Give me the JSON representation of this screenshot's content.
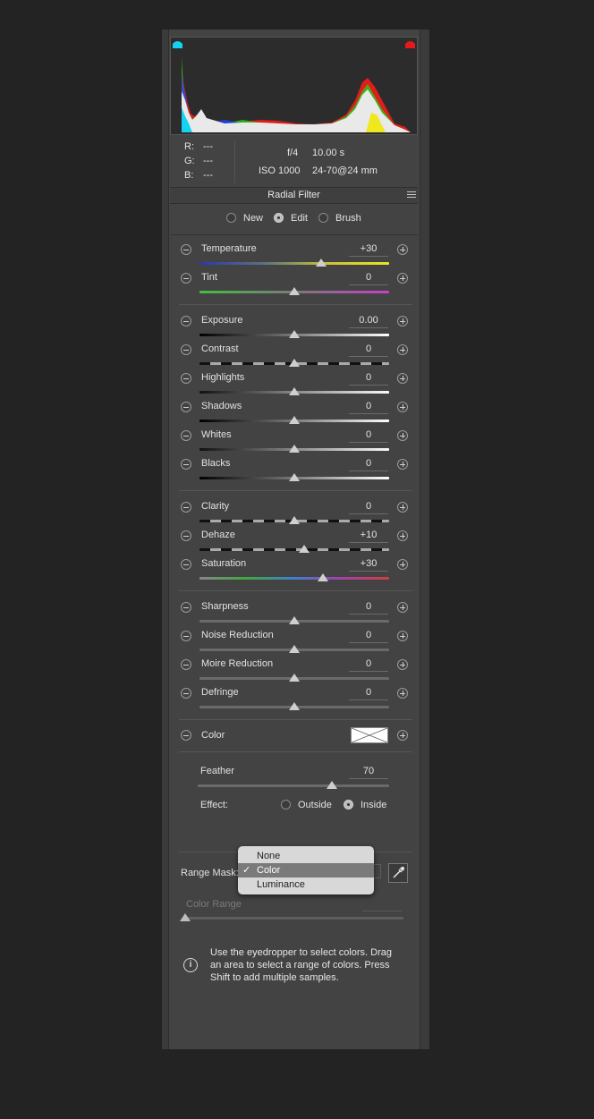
{
  "histogram": {
    "readout": {
      "r_label": "R:",
      "r_val": "---",
      "g_label": "G:",
      "g_val": "---",
      "b_label": "B:",
      "b_val": "---"
    },
    "aperture": "f/4",
    "shutter": "10.00 s",
    "iso": "ISO 1000",
    "lens": "24-70@24 mm"
  },
  "filter": {
    "title": "Radial Filter",
    "menu_icon": "hamburger-icon"
  },
  "mode": {
    "new": "New",
    "edit": "Edit",
    "brush": "Brush",
    "selected": "edit"
  },
  "sliders": [
    {
      "label": "Temperature",
      "value": "+30",
      "pos": 0.64,
      "track": "temp"
    },
    {
      "label": "Tint",
      "value": "0",
      "pos": 0.5,
      "track": "tint"
    },
    {
      "label": "Exposure",
      "value": "0.00",
      "pos": 0.5,
      "track": "dark"
    },
    {
      "label": "Contrast",
      "value": "0",
      "pos": 0.5,
      "track": "contrast"
    },
    {
      "label": "Highlights",
      "value": "0",
      "pos": 0.5,
      "track": "light"
    },
    {
      "label": "Shadows",
      "value": "0",
      "pos": 0.5,
      "track": "dark"
    },
    {
      "label": "Whites",
      "value": "0",
      "pos": 0.5,
      "track": "light"
    },
    {
      "label": "Blacks",
      "value": "0",
      "pos": 0.5,
      "track": "dark"
    },
    {
      "label": "Clarity",
      "value": "0",
      "pos": 0.5,
      "track": "contrast"
    },
    {
      "label": "Dehaze",
      "value": "+10",
      "pos": 0.55,
      "track": "contrast"
    },
    {
      "label": "Saturation",
      "value": "+30",
      "pos": 0.65,
      "track": "sat"
    },
    {
      "label": "Sharpness",
      "value": "0",
      "pos": 0.5,
      "track": "plain"
    },
    {
      "label": "Noise Reduction",
      "value": "0",
      "pos": 0.5,
      "track": "plain"
    },
    {
      "label": "Moire Reduction",
      "value": "0",
      "pos": 0.5,
      "track": "plain"
    },
    {
      "label": "Defringe",
      "value": "0",
      "pos": 0.5,
      "track": "plain"
    }
  ],
  "color": {
    "label": "Color"
  },
  "feather": {
    "label": "Feather",
    "value": "70",
    "pos": 0.7
  },
  "effect": {
    "label": "Effect:",
    "outside": "Outside",
    "inside": "Inside",
    "selected": "inside"
  },
  "range_mask": {
    "label": "Range Mask:",
    "options": [
      "None",
      "Color",
      "Luminance"
    ],
    "selected": "Color",
    "color_range_label": "Color Range",
    "color_range_pos": 0.0
  },
  "info": {
    "text_line1": "Use the eyedropper to select colors. Drag",
    "text_line2": "an area to select a range of colors. Press",
    "text_line3": "Shift to add multiple samples."
  },
  "colors": {
    "panel": "#434343",
    "accent_cyan": "#14d3f0",
    "accent_red": "#e8191c"
  }
}
